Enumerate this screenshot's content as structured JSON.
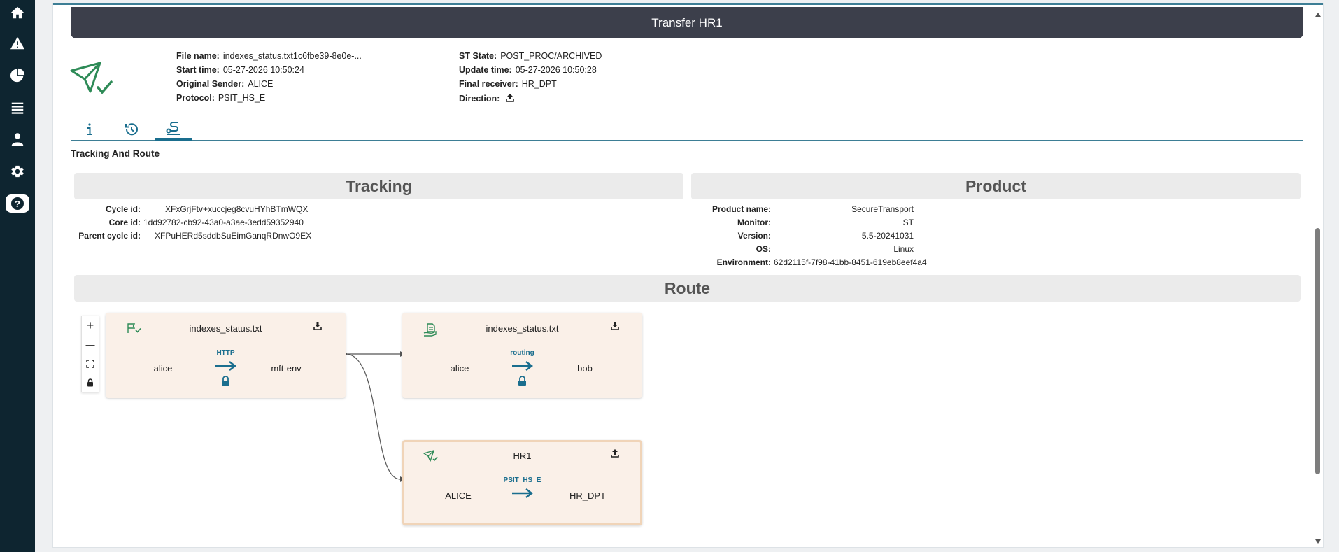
{
  "title": "Transfer HR1",
  "details_left": [
    {
      "label": "File name:",
      "value": "indexes_status.txt1c6fbe39-8e0e-..."
    },
    {
      "label": "Start time:",
      "value": "05-27-2026 10:50:24"
    },
    {
      "label": "Original Sender:",
      "value": "ALICE"
    },
    {
      "label": "Protocol:",
      "value": "PSIT_HS_E"
    }
  ],
  "details_right": [
    {
      "label": "ST State:",
      "value": "POST_PROC/ARCHIVED"
    },
    {
      "label": "Update time:",
      "value": "05-27-2026 10:50:28"
    },
    {
      "label": "Final receiver:",
      "value": "HR_DPT"
    },
    {
      "label": "Direction:",
      "value": "",
      "icon": "upload-icon"
    }
  ],
  "tabs": [
    {
      "name": "info",
      "icon": "info-icon"
    },
    {
      "name": "history",
      "icon": "history-icon"
    },
    {
      "name": "route",
      "icon": "route-icon",
      "active": true
    }
  ],
  "section_title": "Tracking And Route",
  "tracking": {
    "header": "Tracking",
    "rows": [
      {
        "label": "Cycle id:",
        "value": "XFxGrjFtv+xuccjeg8cvuHYhBTmWQX"
      },
      {
        "label": "Core id:",
        "value": "1dd92782-cb92-43a0-a3ae-3edd59352940"
      },
      {
        "label": "Parent cycle id:",
        "value": "XFPuHERd5sddbSuEimGanqRDnwO9EX"
      }
    ]
  },
  "product": {
    "header": "Product",
    "rows": [
      {
        "label": "Product name:",
        "value": "SecureTransport"
      },
      {
        "label": "Monitor:",
        "value": "ST"
      },
      {
        "label": "Version:",
        "value": "5.5-20241031"
      },
      {
        "label": "OS:",
        "value": "Linux"
      },
      {
        "label": "Environment:",
        "value": "62d2115f-7f98-41bb-8451-619eb8eef4a4"
      }
    ]
  },
  "route": {
    "header": "Route",
    "zoom_controls": [
      "+",
      "—"
    ],
    "nodes": [
      {
        "title": "indexes_status.txt",
        "from": "alice",
        "to": "mft-env",
        "protocol": "HTTP",
        "locked": true,
        "left_icon": "flag-check-icon",
        "right_icon": "download-icon"
      },
      {
        "title": "indexes_status.txt",
        "from": "alice",
        "to": "bob",
        "protocol": "routing",
        "locked": true,
        "left_icon": "document-hand-icon",
        "right_icon": "download-icon"
      },
      {
        "title": "HR1",
        "from": "ALICE",
        "to": "HR_DPT",
        "protocol": "PSIT_HS_E",
        "locked": false,
        "left_icon": "send-check-icon",
        "right_icon": "upload-icon",
        "selected": true
      }
    ]
  },
  "colors": {
    "sidebar": "#0e2530",
    "accent": "#1a6e8e",
    "title_bar": "#3c3f4b",
    "node_bg": "#faf0e8",
    "success_green": "#2e8b57"
  }
}
